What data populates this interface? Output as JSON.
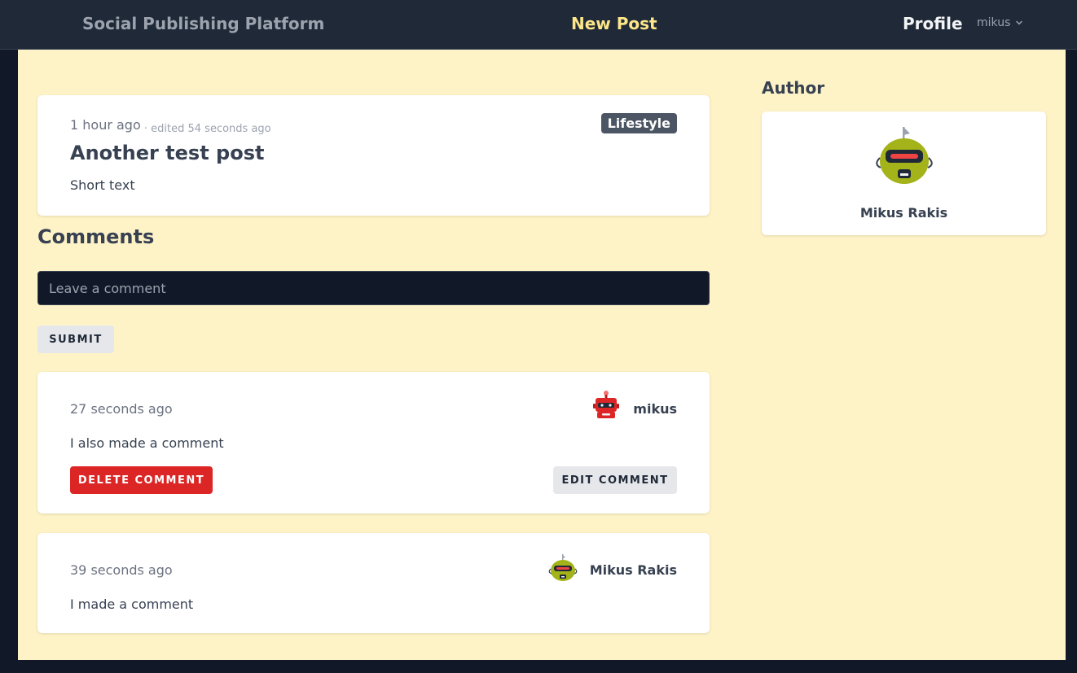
{
  "navbar": {
    "brand": "Social Publishing Platform",
    "new_post": "New Post",
    "profile": "Profile",
    "user_menu": "mikus",
    "user_menu_icon": "chevron-down-icon"
  },
  "post": {
    "time": "1 hour ago",
    "edited": "· edited 54 seconds ago",
    "category": "Lifestyle",
    "title": "Another test post",
    "body": "Short text"
  },
  "comments": {
    "heading": "Comments",
    "input_placeholder": "Leave a comment",
    "input_value": "",
    "submit_label": "SUBMIT",
    "items": [
      {
        "time": "27 seconds ago",
        "author": "mikus",
        "avatar_icon": "red-robot-avatar-icon",
        "text": "I also made a comment",
        "delete_label": "DELETE COMMENT",
        "edit_label": "EDIT COMMENT"
      },
      {
        "time": "39 seconds ago",
        "author": "Mikus Rakis",
        "avatar_icon": "green-robot-avatar-icon",
        "text": "I made a comment"
      }
    ]
  },
  "author_panel": {
    "heading": "Author",
    "name": "Mikus Rakis",
    "avatar_icon": "green-robot-avatar-icon"
  },
  "colors": {
    "navbar_bg": "#1f2937",
    "page_bg": "#111827",
    "content_bg": "#fef3c7",
    "accent_new_post": "#fde68a",
    "tag_bg": "#4b5563",
    "delete_bg": "#dc2626",
    "secondary_button_bg": "#e5e7eb"
  }
}
